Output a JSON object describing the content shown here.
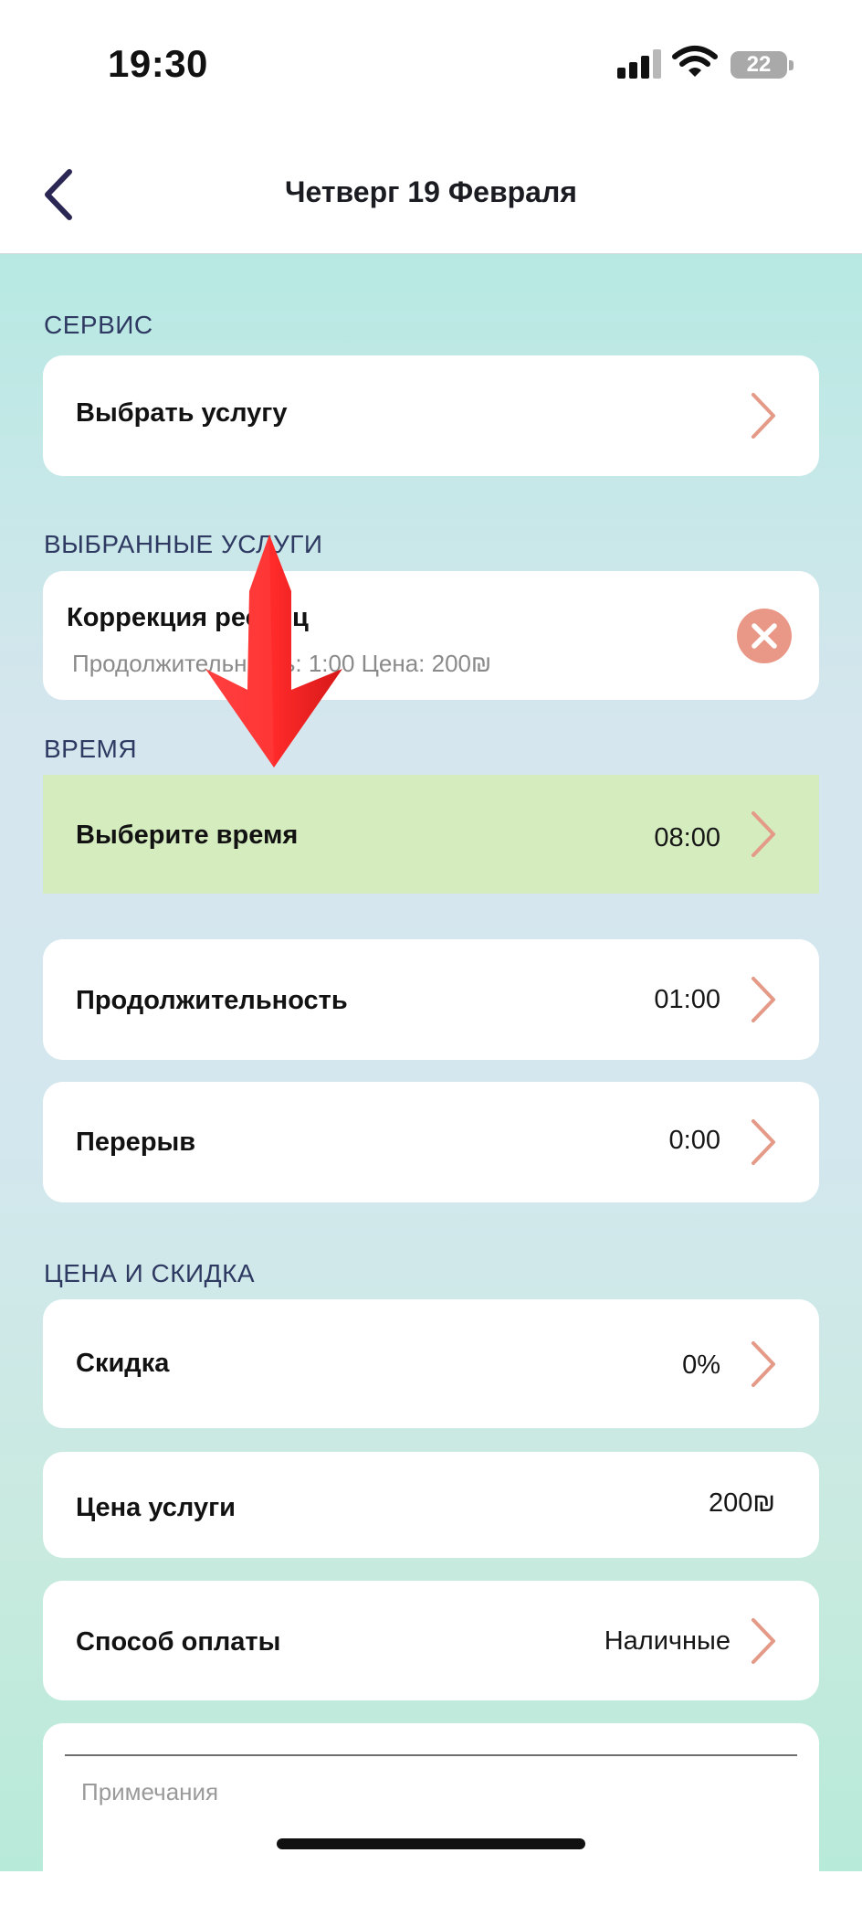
{
  "status_bar": {
    "time": "19:30",
    "battery": "22"
  },
  "header": {
    "title": "Четверг 19 Февраля"
  },
  "sections": {
    "service": "СЕРВИС",
    "selected": "ВЫБРАННЫЕ УСЛУГИ",
    "time": "ВРЕМЯ",
    "price": "ЦЕНА И СКИДКА"
  },
  "service_row": {
    "label": "Выбрать услугу"
  },
  "selected_service": {
    "name": "Коррекция ресниц",
    "details": "Продолжительность: 1:00 Цена: 200₪"
  },
  "time_rows": {
    "choose_time": {
      "label": "Выберите время",
      "value": "08:00"
    },
    "duration": {
      "label": "Продолжительность",
      "value": "01:00"
    },
    "break": {
      "label": "Перерыв",
      "value": "0:00"
    }
  },
  "price_rows": {
    "discount": {
      "label": "Скидка",
      "value": "0%"
    },
    "service_price": {
      "label": "Цена услуги",
      "value": "200₪"
    },
    "payment": {
      "label": "Способ оплаты",
      "value": "Наличные"
    }
  },
  "notes": {
    "placeholder": "Примечания"
  },
  "colors": {
    "accent_chevron": "#e49a86",
    "highlight_row": "#d4ecbe",
    "section_text": "#2f3a63",
    "arrow": "#ff2f2f"
  },
  "icons": [
    "back-chevron-icon",
    "signal-icon",
    "wifi-icon",
    "battery-icon",
    "chevron-right-icon",
    "close-icon",
    "red-arrow-annotation"
  ]
}
